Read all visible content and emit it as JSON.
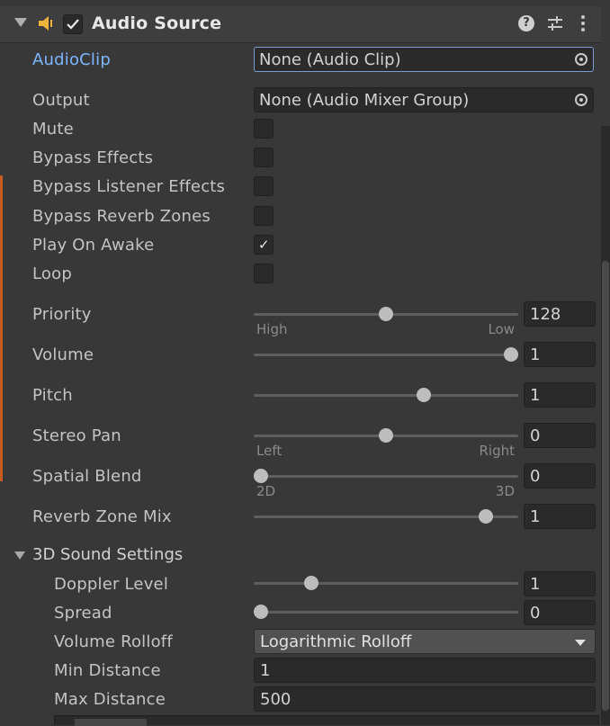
{
  "component": {
    "title": "Audio Source",
    "enabled": true,
    "icons": [
      "speaker-icon",
      "help-icon",
      "presets-icon",
      "kebab-menu-icon"
    ]
  },
  "audio_clip": {
    "label": "AudioClip",
    "value": "None (Audio Clip)"
  },
  "output": {
    "label": "Output",
    "value": "None (Audio Mixer Group)"
  },
  "toggles": [
    {
      "label": "Mute",
      "checked": false
    },
    {
      "label": "Bypass Effects",
      "checked": false
    },
    {
      "label": "Bypass Listener Effects",
      "checked": false
    },
    {
      "label": "Bypass Reverb Zones",
      "checked": false
    },
    {
      "label": "Play On Awake",
      "checked": true,
      "check_glyph": "✓"
    },
    {
      "label": "Loop",
      "checked": false
    }
  ],
  "sliders": [
    {
      "label": "Priority",
      "value": "128",
      "fraction": 0.5,
      "min_label": "High",
      "max_label": "Low"
    },
    {
      "label": "Volume",
      "value": "1",
      "fraction": 1.0
    },
    {
      "label": "Pitch",
      "value": "1",
      "fraction": 0.65
    },
    {
      "label": "Stereo Pan",
      "value": "0",
      "fraction": 0.5,
      "min_label": "Left",
      "max_label": "Right"
    },
    {
      "label": "Spatial Blend",
      "value": "0",
      "fraction": 0.0,
      "min_label": "2D",
      "max_label": "3D"
    },
    {
      "label": "Reverb Zone Mix",
      "value": "1",
      "fraction": 0.9
    }
  ],
  "sound_3d": {
    "section_label": "3D Sound Settings",
    "doppler": {
      "label": "Doppler Level",
      "value": "1",
      "fraction": 0.2
    },
    "spread": {
      "label": "Spread",
      "value": "0",
      "fraction": 0.0
    },
    "rolloff": {
      "label": "Volume Rolloff",
      "value": "Logarithmic Rolloff"
    },
    "min_distance": {
      "label": "Min Distance",
      "value": "1"
    },
    "max_distance": {
      "label": "Max Distance",
      "value": "500"
    }
  },
  "colors": {
    "background": "#383838",
    "accent_label": "#7cb7ff",
    "field": "#2a2a2a",
    "thumb": "#bdbdbd",
    "left_accent": "#c75a1e"
  }
}
